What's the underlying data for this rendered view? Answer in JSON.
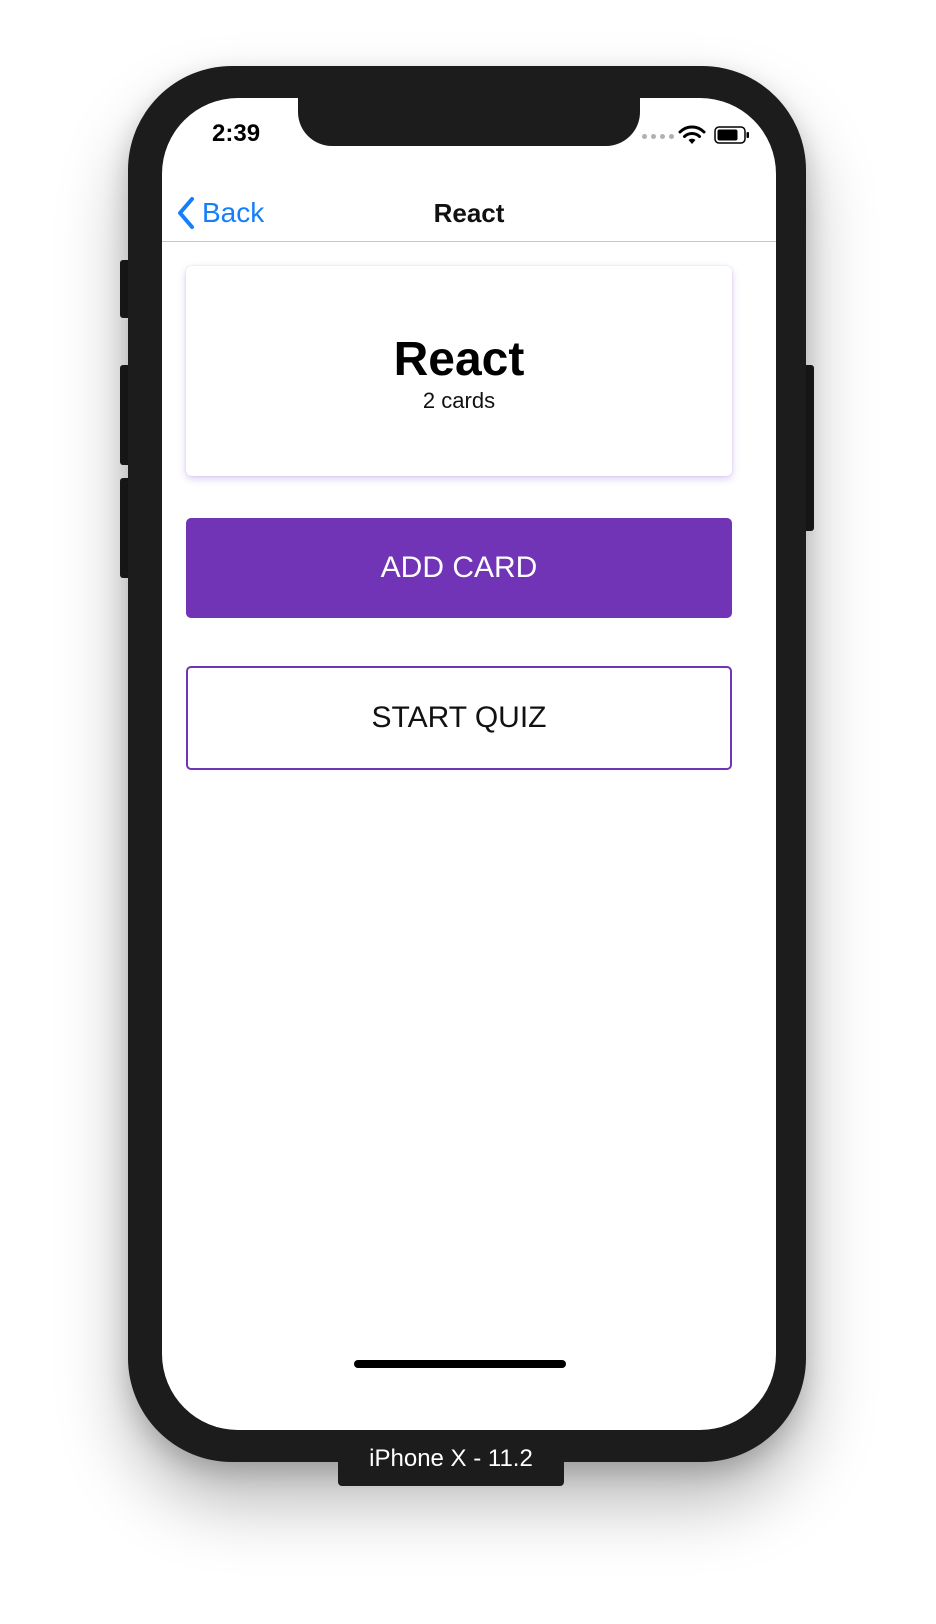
{
  "status_bar": {
    "time": "2:39"
  },
  "nav": {
    "back_label": "Back",
    "title": "React"
  },
  "deck": {
    "title": "React",
    "count_label": "2 cards"
  },
  "actions": {
    "add_card_label": "ADD CARD",
    "start_quiz_label": "START QUIZ"
  },
  "simulator": {
    "device_label": "iPhone X - 11.2"
  },
  "colors": {
    "accent": "#7134b6",
    "ios_blue": "#147efb",
    "frame": "#1c1c1c"
  },
  "icons": {
    "back": "chevron-left-icon",
    "wifi": "wifi-icon",
    "battery": "battery-icon",
    "signal": "signal-dots-icon"
  }
}
